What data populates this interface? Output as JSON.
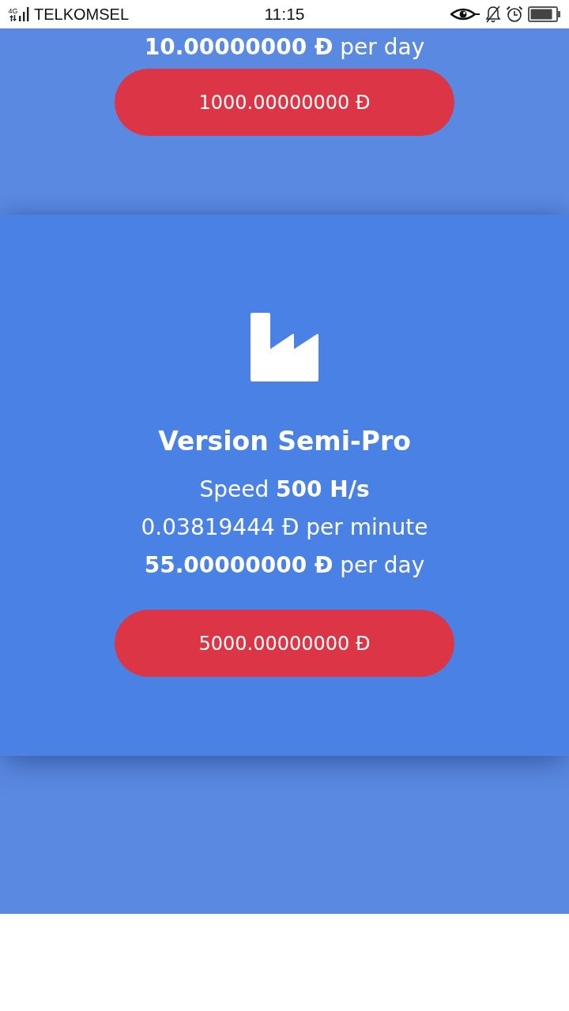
{
  "status_bar": {
    "network": "4G",
    "carrier": "TELKOMSEL",
    "time": "11:15"
  },
  "plans": [
    {
      "kind": "cut",
      "highlighted": false,
      "lines": [
        "**10.00000000 Đ** per day"
      ],
      "price": "1000.00000000 Đ"
    },
    {
      "kind": "full",
      "highlighted": true,
      "title": "Version Semi-Pro",
      "lines": [
        "Speed **500 H/s**",
        "0.03819444 Đ per minute",
        "**55.00000000 Đ** per day"
      ],
      "price": "5000.00000000 Đ"
    },
    {
      "kind": "blank",
      "highlighted": false
    }
  ]
}
